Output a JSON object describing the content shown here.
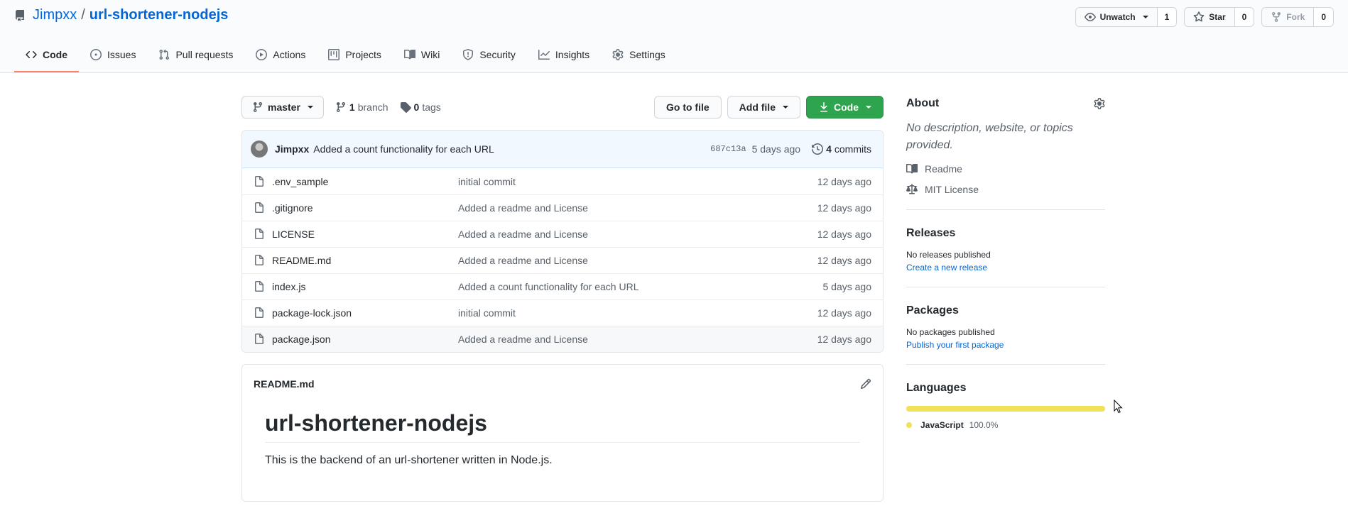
{
  "repo": {
    "owner": "Jimpxx",
    "separator": "/",
    "name": "url-shortener-nodejs"
  },
  "actions": {
    "watch_label": "Unwatch",
    "watch_count": "1",
    "star_label": "Star",
    "star_count": "0",
    "fork_label": "Fork",
    "fork_count": "0"
  },
  "tabs": [
    {
      "label": "Code",
      "icon": "code-icon",
      "selected": true
    },
    {
      "label": "Issues",
      "icon": "issue-icon"
    },
    {
      "label": "Pull requests",
      "icon": "pull-request-icon"
    },
    {
      "label": "Actions",
      "icon": "play-icon"
    },
    {
      "label": "Projects",
      "icon": "project-icon"
    },
    {
      "label": "Wiki",
      "icon": "book-icon"
    },
    {
      "label": "Security",
      "icon": "shield-icon"
    },
    {
      "label": "Insights",
      "icon": "graph-icon"
    },
    {
      "label": "Settings",
      "icon": "gear-icon"
    }
  ],
  "filenav": {
    "branch": "master",
    "branch_count": "1",
    "branch_label": "branch",
    "tag_count": "0",
    "tag_label": "tags",
    "go_to_file": "Go to file",
    "add_file": "Add file",
    "code": "Code"
  },
  "commit": {
    "author": "Jimpxx",
    "message": "Added a count functionality for each URL",
    "sha": "687c13a",
    "age": "5 days ago",
    "count": "4",
    "count_label": "commits"
  },
  "files": [
    {
      "name": ".env_sample",
      "message": "initial commit",
      "age": "12 days ago"
    },
    {
      "name": ".gitignore",
      "message": "Added a readme and License",
      "age": "12 days ago"
    },
    {
      "name": "LICENSE",
      "message": "Added a readme and License",
      "age": "12 days ago"
    },
    {
      "name": "README.md",
      "message": "Added a readme and License",
      "age": "12 days ago"
    },
    {
      "name": "index.js",
      "message": "Added a count functionality for each URL",
      "age": "5 days ago"
    },
    {
      "name": "package-lock.json",
      "message": "initial commit",
      "age": "12 days ago"
    },
    {
      "name": "package.json",
      "message": "Added a readme and License",
      "age": "12 days ago"
    }
  ],
  "readme": {
    "filename": "README.md",
    "heading": "url-shortener-nodejs",
    "paragraph": "This is the backend of an url-shortener written in Node.js."
  },
  "sidebar": {
    "about_title": "About",
    "about_desc": "No description, website, or topics provided.",
    "readme_link": "Readme",
    "license_link": "MIT License",
    "releases_title": "Releases",
    "releases_none": "No releases published",
    "releases_action": "Create a new release",
    "packages_title": "Packages",
    "packages_none": "No packages published",
    "packages_action": "Publish your first package",
    "languages_title": "Languages",
    "language_name": "JavaScript",
    "language_pct": "100.0%"
  },
  "colors": {
    "accent_link": "#0366d6",
    "tab_underline": "#f9826c",
    "code_button": "#2ea44f",
    "javascript": "#f1e05a"
  }
}
